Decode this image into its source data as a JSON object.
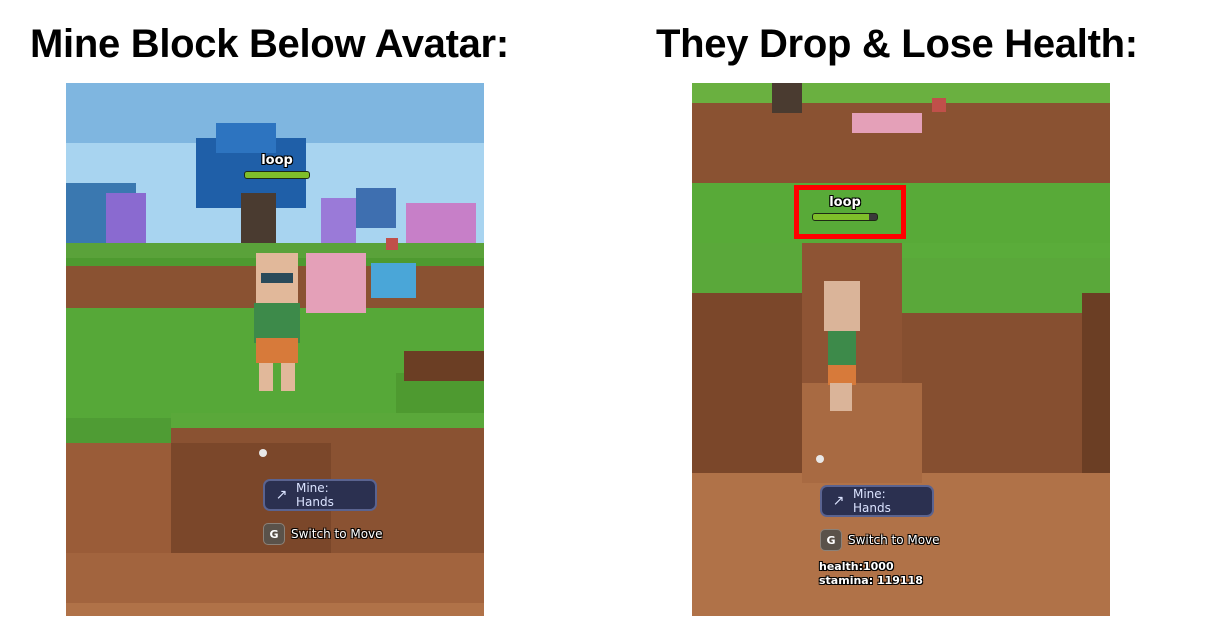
{
  "headings": {
    "left": "Mine Block Below Avatar:",
    "right": "They Drop & Lose Health:"
  },
  "left_panel": {
    "player_name": "loop",
    "health_fraction": 1.0,
    "tool_label": "Mine: Hands",
    "tool_icon": "pickaxe-icon",
    "key": "G",
    "key_hint": "Switch to Move"
  },
  "right_panel": {
    "player_name": "loop",
    "health_fraction": 0.88,
    "tool_label": "Mine: Hands",
    "tool_icon": "pickaxe-icon",
    "key": "G",
    "key_hint": "Switch to Move",
    "stats": {
      "health_label": "health:",
      "health_value": "1000",
      "stamina_label": "stamina:",
      "stamina_value": "119118"
    }
  },
  "colors": {
    "grass": "#5cae3c",
    "dirt": "#8a5232",
    "highlight": "#ff0000",
    "sky": "#9fd0ef"
  }
}
